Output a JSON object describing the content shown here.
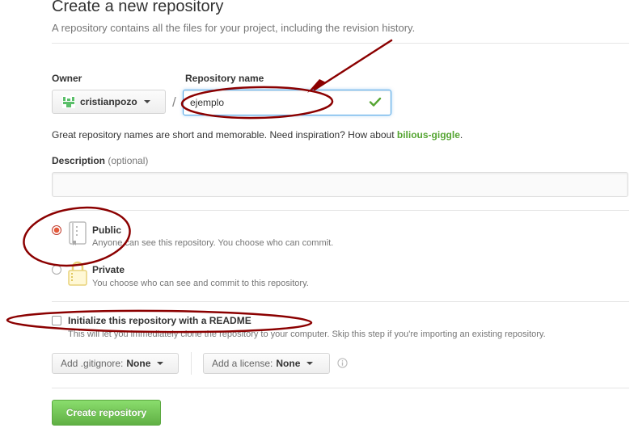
{
  "header": {
    "title": "Create a new repository",
    "subtitle": "A repository contains all the files for your project, including the revision history."
  },
  "owner": {
    "label": "Owner",
    "name": "cristianpozo",
    "avatar_icon": "identicon-icon"
  },
  "repository": {
    "label": "Repository name",
    "separator": "/",
    "value": "ejemplo",
    "valid_icon": "check-icon",
    "hint_prefix": "Great repository names are short and memorable. Need inspiration? How about ",
    "suggestion": "bilious-giggle",
    "hint_suffix": "."
  },
  "description": {
    "label": "Description",
    "optional": "(optional)",
    "value": ""
  },
  "visibility": {
    "public": {
      "title": "Public",
      "desc": "Anyone can see this repository. You choose who can commit.",
      "icon": "repo-book-icon",
      "selected": true
    },
    "private": {
      "title": "Private",
      "desc": "You choose who can see and commit to this repository.",
      "icon": "lock-icon",
      "selected": false
    }
  },
  "readme": {
    "label": "Initialize this repository with a README",
    "desc": "This will let you immediately clone the repository to your computer. Skip this step if you're importing an existing repository.",
    "checked": false
  },
  "gitignore": {
    "label": "Add .gitignore:",
    "value": "None"
  },
  "license": {
    "label": "Add a license:",
    "value": "None",
    "info_icon": "info-icon"
  },
  "submit": {
    "label": "Create repository"
  },
  "annotations": {
    "color": "#8b0000"
  },
  "colors": {
    "primary_button": "#60b044",
    "suggestion": "#55a532",
    "focus_border": "#51a7e8",
    "radio_selected": "#e45a3a"
  }
}
